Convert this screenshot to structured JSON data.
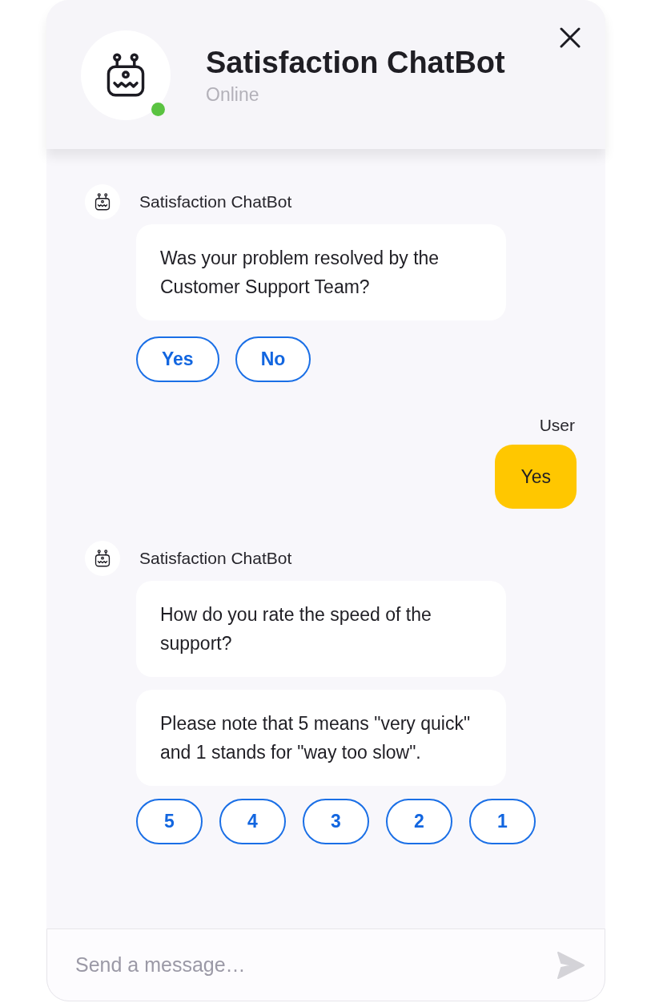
{
  "header": {
    "title": "Satisfaction ChatBot",
    "status": "Online",
    "online": true
  },
  "messages": [
    {
      "kind": "bot",
      "sender": "Satisfaction ChatBot",
      "bubbles": [
        "Was your problem resolved by the Customer Support Team?"
      ],
      "options": [
        "Yes",
        "No"
      ]
    },
    {
      "kind": "user",
      "sender": "User",
      "bubbles": [
        "Yes"
      ]
    },
    {
      "kind": "bot",
      "sender": "Satisfaction ChatBot",
      "bubbles": [
        "How do you rate the speed of the support?",
        "Please note that 5 means \"very quick\" and 1 stands for \"way too slow\"."
      ],
      "options": [
        "5",
        "4",
        "3",
        "2",
        "1"
      ]
    }
  ],
  "composer": {
    "placeholder": "Send a message…"
  }
}
